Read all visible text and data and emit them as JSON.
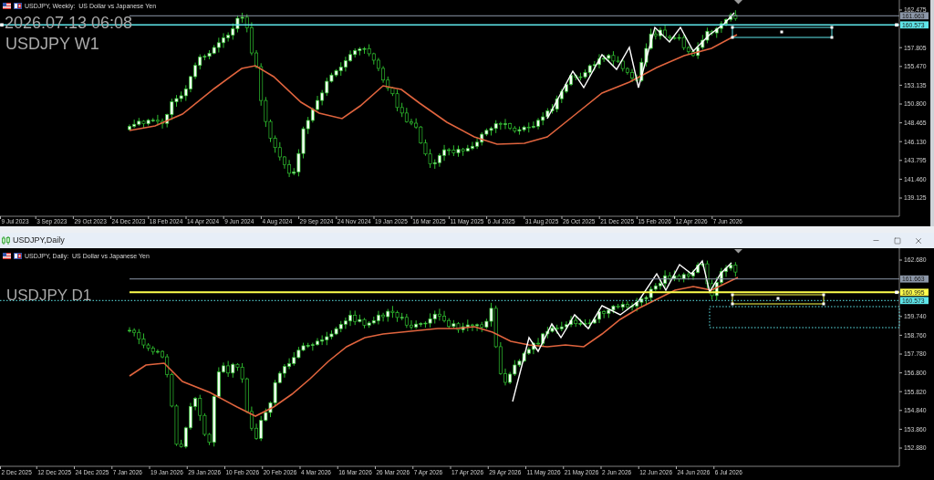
{
  "weekly_chart": {
    "header": "USDJPY, Weekly:  US Dollar vs Japanese Yen",
    "time_label": "2026.07.13 06:08",
    "symbol_label": "USDJPY W1",
    "price_axis": [
      "162.475",
      "157.805",
      "155.470",
      "153.135",
      "150.800",
      "148.465",
      "146.130",
      "143.795",
      "141.460",
      "139.125"
    ],
    "levels": [
      {
        "price": "161.663",
        "color": "#8c97a8"
      },
      {
        "price": "160.573",
        "color": "#5ee6ea"
      }
    ],
    "time_axis": [
      "9 Jul 2023",
      "3 Sep 2023",
      "29 Oct 2023",
      "24 Dec 2023",
      "18 Feb 2024",
      "14 Apr 2024",
      "9 Jun 2024",
      "4 Aug 2024",
      "29 Sep 2024",
      "24 Nov 2024",
      "19 Jan 2025",
      "16 Mar 2025",
      "11 May 2025",
      "6 Jul 2025",
      "31 Aug 2025",
      "26 Oct 2025",
      "21 Dec 2025",
      "15 Feb 2026",
      "12 Apr 2026",
      "7 Jun 2026"
    ]
  },
  "daily_window": {
    "title": "USDJPY,Daily",
    "chart": {
      "header": "USDJPY, Daily:  US Dollar vs Japanese Yen",
      "symbol_label": "USDJPY D1",
      "price_axis": [
        "162.680",
        "159.740",
        "158.760",
        "157.780",
        "156.800",
        "155.820",
        "154.840",
        "153.860",
        "152.880"
      ],
      "levels": [
        {
          "price": "161.663",
          "color": "#8c97a8"
        },
        {
          "price": "160.995",
          "color": "#ffff4d"
        },
        {
          "price": "160.573",
          "color": "#5ee6ea"
        }
      ],
      "time_axis": [
        "2 Dec 2025",
        "12 Dec 2025",
        "24 Dec 2025",
        "7 Jan 2026",
        "19 Jan 2026",
        "29 Jan 2026",
        "10 Feb 2026",
        "20 Feb 2026",
        "4 Mar 2026",
        "16 Mar 2026",
        "26 Mar 2026",
        "7 Apr 2026",
        "17 Apr 2026",
        "29 Apr 2026",
        "11 May 2026",
        "21 May 2026",
        "2 Jun 2026",
        "12 Jun 2026",
        "24 Jun 2026",
        "6 Jul 2026"
      ]
    }
  }
}
